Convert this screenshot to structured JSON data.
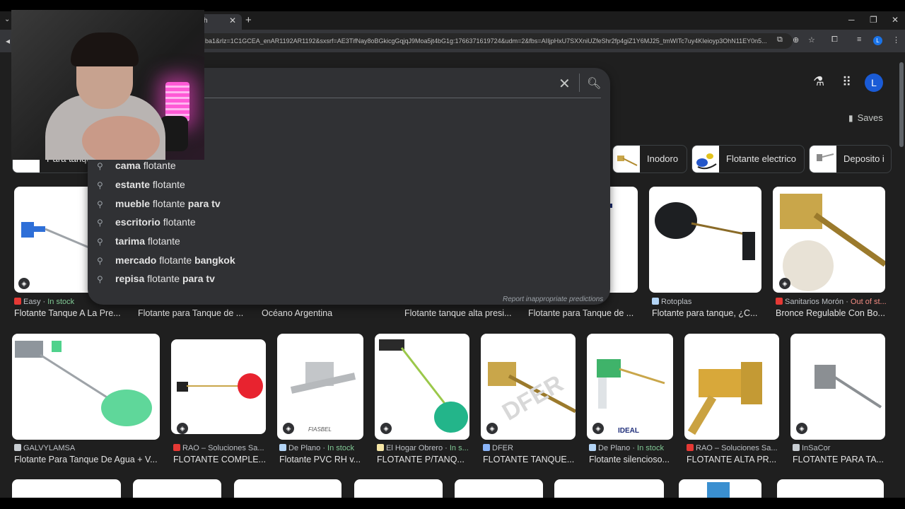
{
  "browser": {
    "tab_title": "h",
    "url": "ba1&rlz=1C1GCEA_enAR1192AR1192&sxsrf=AE3TifNay8oBGkicgGqjqJ9Moa5jt4bG1g:1766371619724&udm=2&fbs=AIIjpHxU7SXXniUZfeShr2fp4giZ1Y6MJ25_tmWITc7uy4KIeioyp3OhN11EY0n5...",
    "profile_letter": "L"
  },
  "header": {
    "avatar_letter": "L",
    "saves_label": "Saves"
  },
  "chips": [
    {
      "label": "Para tanque"
    },
    {
      "label": "Inodoro"
    },
    {
      "label": "Flotante electrico"
    },
    {
      "label": "Deposito i"
    }
  ],
  "suggestions": {
    "items": [
      {
        "pre": "cama",
        "mid": " flotante",
        "post": ""
      },
      {
        "pre": "estante",
        "mid": " flotante",
        "post": ""
      },
      {
        "pre": "mueble",
        "mid": " flotante ",
        "post": "para tv"
      },
      {
        "pre": "escritorio",
        "mid": " flotante",
        "post": ""
      },
      {
        "pre": "tarima",
        "mid": " flotante",
        "post": ""
      },
      {
        "pre": "mercado",
        "mid": " flotante ",
        "post": "bangkok"
      },
      {
        "pre": "repisa",
        "mid": " flotante ",
        "post": "para tv"
      }
    ],
    "report_label": "Report inappropriate predictions"
  },
  "row1": [
    {
      "source": "Easy",
      "stock": "In stock",
      "title": "Flotante Tanque A La Pre..."
    },
    {
      "source": "",
      "stock": "",
      "title": "Flotante para Tanque de ..."
    },
    {
      "source": "",
      "stock": "",
      "title": "Océano Argentina"
    },
    {
      "source": "",
      "stock": "",
      "title": "Flotante tanque alta presi..."
    },
    {
      "source": "",
      "stock": "",
      "title": "Flotante para Tanque de ..."
    },
    {
      "source": "Rotoplas",
      "stock": "",
      "title": "Flotante para tanque, ¿C..."
    },
    {
      "source": "Sanitarios Morón",
      "stock": "Out of st...",
      "title": "Bronce Regulable Con Bo..."
    }
  ],
  "row2": [
    {
      "source": "GALVYLAMSA",
      "stock": "",
      "title": "Flotante Para Tanque De Agua + V..."
    },
    {
      "source": "RAO – Soluciones Sa...",
      "stock": "",
      "title": "FLOTANTE COMPLE..."
    },
    {
      "source": "De Plano",
      "stock": "In stock",
      "title": "Flotante PVC RH v..."
    },
    {
      "source": "El Hogar Obrero",
      "stock": "In s...",
      "title": "FLOTANTE P/TANQ..."
    },
    {
      "source": "DFER",
      "stock": "",
      "title": "FLOTANTE TANQUE..."
    },
    {
      "source": "De Plano",
      "stock": "In stock",
      "title": "Flotante silencioso..."
    },
    {
      "source": "RAO – Soluciones Sa...",
      "stock": "",
      "title": "FLOTANTE ALTA PR..."
    },
    {
      "source": "InSaCor",
      "stock": "",
      "title": "FLOTANTE PARA TA..."
    }
  ],
  "image_text": {
    "dfer_watermark": "DFER",
    "ideal_logo": "IDEAL",
    "fiasbel_logo": "FIASBEL"
  }
}
